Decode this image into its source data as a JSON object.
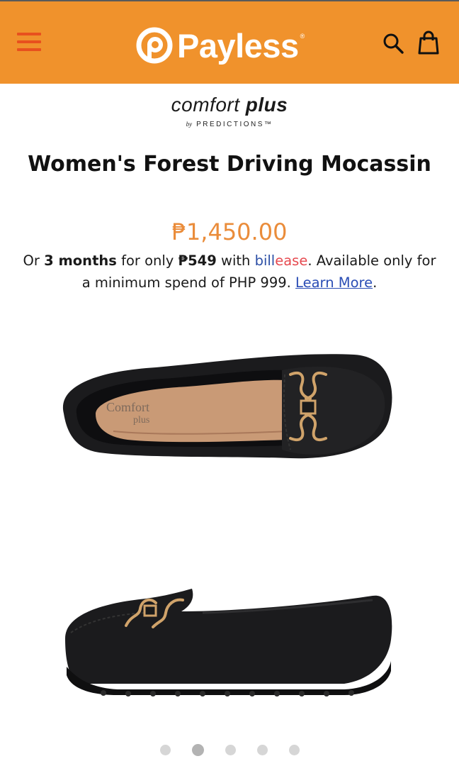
{
  "header": {
    "brand_name": "Payless",
    "tm": "®",
    "menu_icon": "hamburger-menu-icon",
    "search_icon": "search-icon",
    "cart_icon": "shopping-bag-icon",
    "bg_color": "#f0922c",
    "menu_color": "#e8501e"
  },
  "brand_logo": {
    "comfort": "comfort",
    "plus": "plus",
    "by": "by",
    "predictions": "PREDICTIONS™"
  },
  "product": {
    "title": "Women's Forest Driving Mocassin",
    "price": "₱1,450.00",
    "price_color": "#ea8c3a",
    "installment": {
      "prefix": "Or ",
      "months": "3 months",
      "mid": " for only ",
      "amount": "₱549",
      "with": " with ",
      "bill": "bill",
      "ease": "ease",
      "suffix": ". Available only for a minimum spend of PHP 999. ",
      "learn_more": "Learn More",
      "period": "."
    },
    "insole_text_1": "Comfort",
    "insole_text_2": "plus"
  },
  "carousel": {
    "slide_count": 5,
    "active_index": 1
  }
}
